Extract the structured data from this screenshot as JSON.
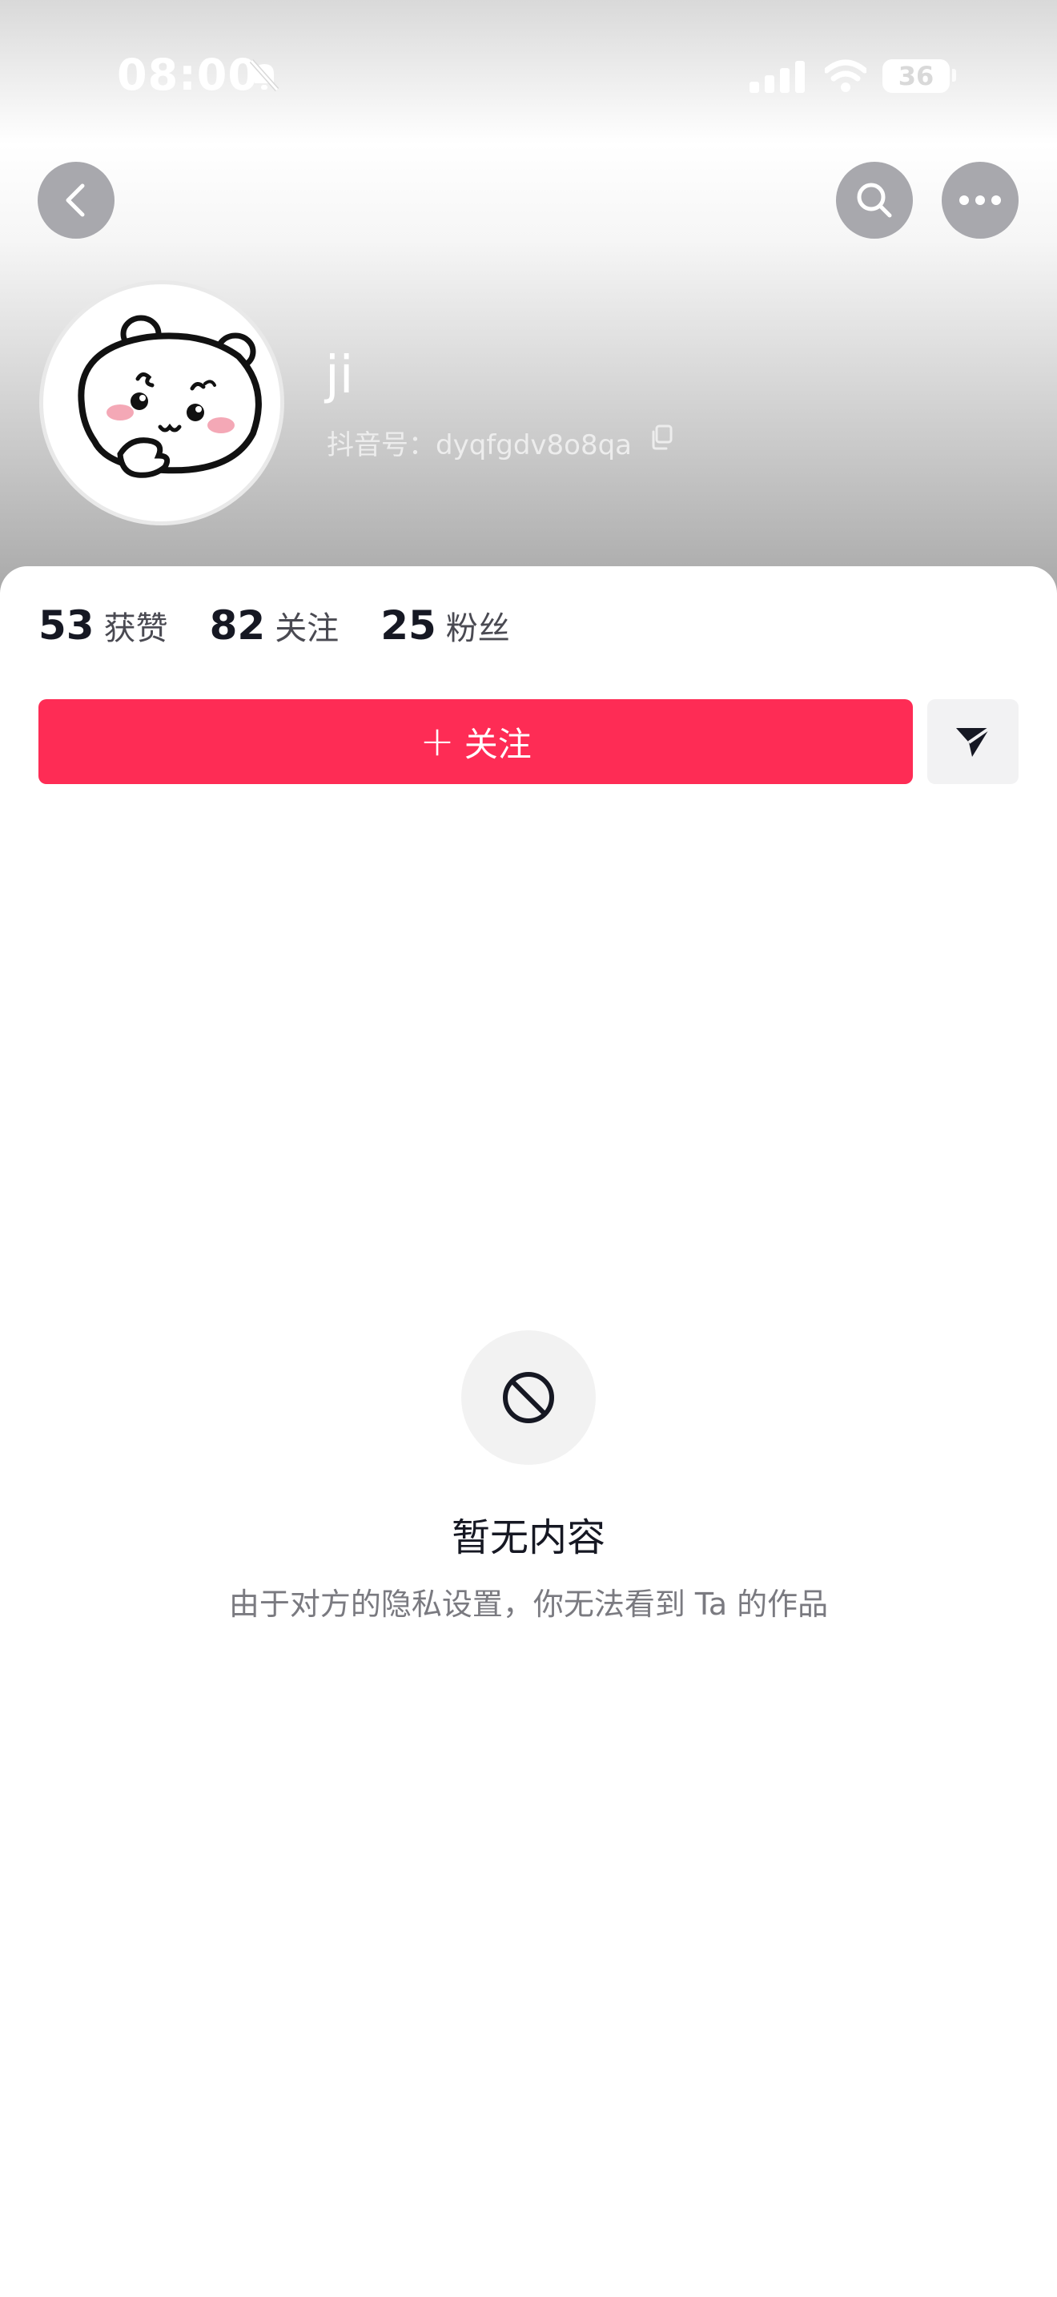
{
  "status_bar": {
    "time": "08:00",
    "battery": "36",
    "icons": [
      "bell-slash-icon",
      "signal-icon",
      "wifi-icon",
      "battery-icon"
    ]
  },
  "nav": {
    "icons": [
      "chevron-left-icon",
      "search-icon",
      "more-horizontal-icon"
    ]
  },
  "profile": {
    "name": "ji",
    "douyin_id": "抖音号：dyqfgdv8o8qa",
    "avatar_icon": "cartoon-hamster-avatar"
  },
  "stats": [
    {
      "value": "53",
      "label": "获赞"
    },
    {
      "value": "82",
      "label": "关注"
    },
    {
      "value": "25",
      "label": "粉丝"
    }
  ],
  "actions": {
    "follow_plus": "+",
    "follow_label": "关注",
    "send_icon": "send-icon"
  },
  "empty_state": {
    "icon": "prohibited-icon",
    "title": "暂无内容",
    "description": "由于对方的隐私设置，你无法看到 Ta 的作品"
  },
  "colors": {
    "accent": "#fe2c55",
    "text_primary": "#161823",
    "text_secondary": "#7a7a80",
    "button_overlay": "#a8a8ad"
  }
}
